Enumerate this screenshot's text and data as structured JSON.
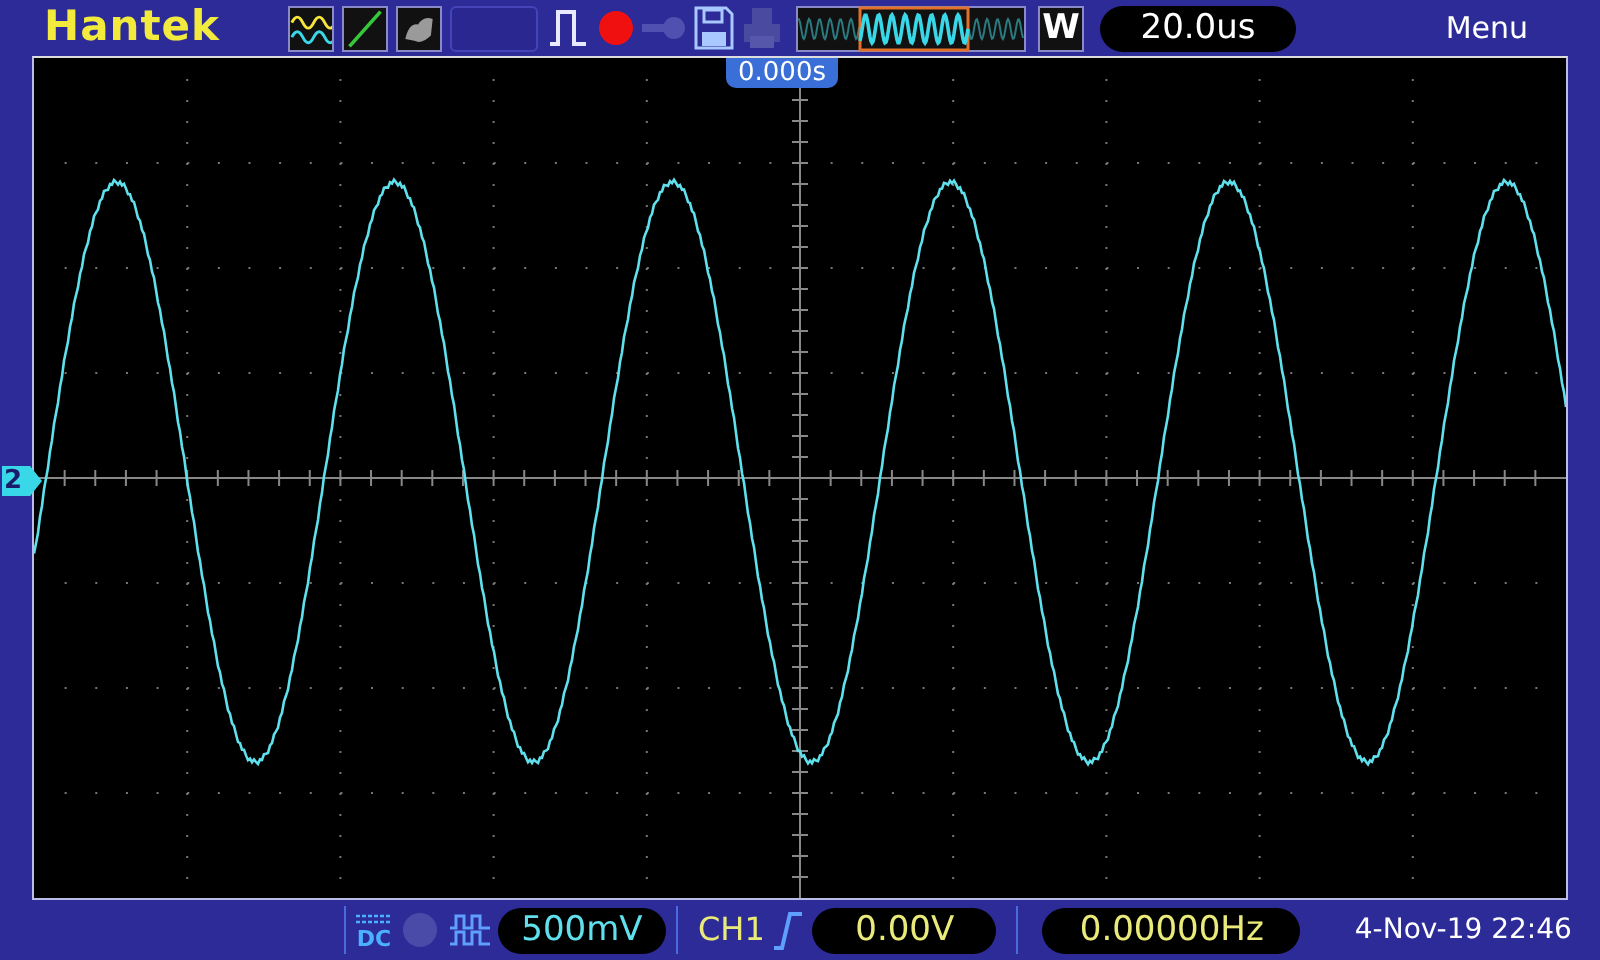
{
  "top_bar": {
    "brand": "Hantek",
    "mode_letter": "W",
    "timebase": "20.0us",
    "menu": "Menu"
  },
  "screen": {
    "trigger_position": "0.000s",
    "channel_marker": "2"
  },
  "bottom_bar": {
    "coupling": "DC",
    "volts_per_div": "500mV",
    "trigger_source": "CH1",
    "trigger_level": "0.00V",
    "frequency": "0.00000Hz",
    "datetime": "4-Nov-19 22:46"
  }
}
